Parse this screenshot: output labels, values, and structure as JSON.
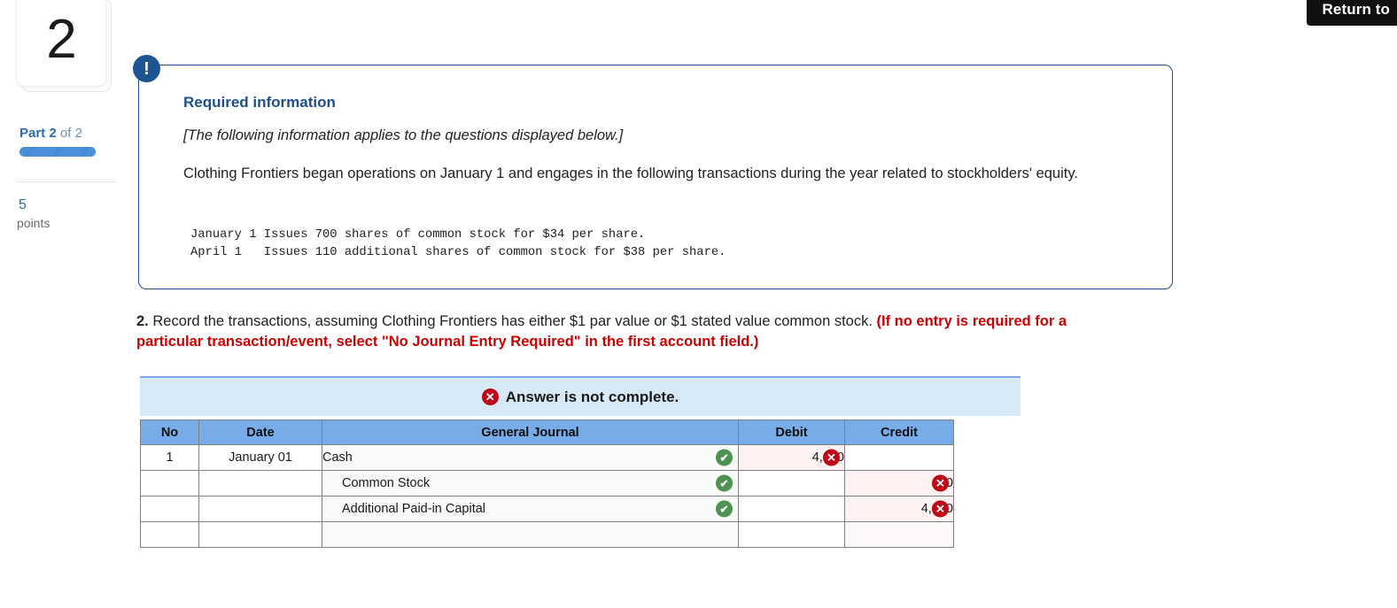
{
  "rail": {
    "question_number": "2",
    "part_prefix": "Part",
    "part_current": "2",
    "part_middle": "of",
    "part_total": "2",
    "points_value": "5",
    "points_label": "points",
    "progress_percent": 100,
    "accent_color": "#2b6cb0"
  },
  "header": {
    "return_button_label": "Return to"
  },
  "callout": {
    "badge_glyph": "!",
    "title": "Required information",
    "italic_note": "[The following information applies to the questions displayed below.]",
    "body": "Clothing Frontiers began operations on January 1 and engages in the following transactions during the year related to stockholders' equity.",
    "transactions_pre": "January 1 Issues 700 shares of common stock for $34 per share.\nApril 1   Issues 110 additional shares of common stock for $38 per share.",
    "border_color": "#1d4f8c"
  },
  "prompt": {
    "number": "2.",
    "text": " Record the transactions, assuming Clothing Frontiers has either $1 par value or $1 stated value common stock. ",
    "red_text": "(If no entry is required for a particular transaction/event, select \"No Journal Entry Required\" in the first account field.)",
    "red_color": "#cc0000"
  },
  "banner": {
    "icon": "x-circle-icon",
    "icon_glyph": "✕",
    "text": "Answer is not complete.",
    "background": "#d7e8f7",
    "icon_color": "#c00418"
  },
  "table": {
    "headers": [
      "No",
      "Date",
      "General Journal",
      "Debit",
      "Credit"
    ],
    "header_background": "#77ace8",
    "rows": [
      {
        "no": "1",
        "date": "January 01",
        "account": "Cash",
        "indent": false,
        "account_mark": "correct",
        "debit": "4,180",
        "debit_mark": "incorrect",
        "credit": "",
        "credit_mark": ""
      },
      {
        "no": "",
        "date": "",
        "account": "Common Stock",
        "indent": true,
        "account_mark": "correct",
        "debit": "",
        "debit_mark": "",
        "credit": "110",
        "credit_mark": "incorrect"
      },
      {
        "no": "",
        "date": "",
        "account": "Additional Paid-in Capital",
        "indent": true,
        "account_mark": "correct",
        "debit": "",
        "debit_mark": "",
        "credit": "4,070",
        "credit_mark": "incorrect"
      },
      {
        "no": "",
        "date": "",
        "account": "",
        "indent": false,
        "account_mark": "",
        "debit": "",
        "debit_mark": "",
        "credit": "",
        "credit_mark": ""
      }
    ],
    "correct_glyph": "✔",
    "incorrect_glyph": "✕",
    "correct_color": "#4f9152",
    "incorrect_color": "#c00418"
  }
}
